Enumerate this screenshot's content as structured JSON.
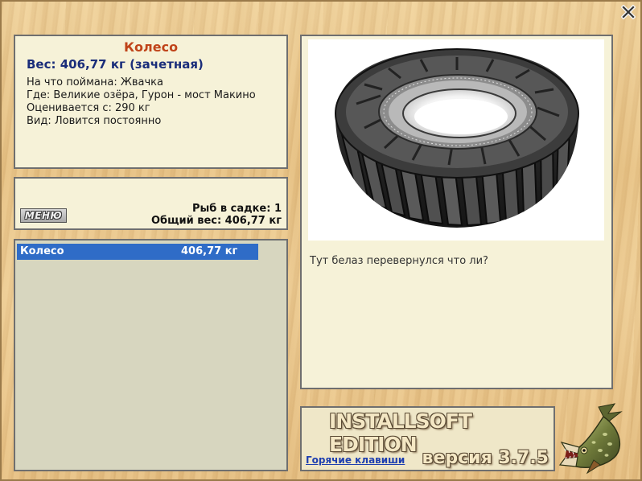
{
  "fish": {
    "name": "Колесо",
    "weight_line": "Вес: 406,77 кг (зачетная)",
    "caught_on": "На что поймана: Жвачка",
    "location": "Где: Великие озёра, Гурон - мост Макино",
    "value": "Оценивается с: 290 кг",
    "type": "Вид: Ловится постоянно",
    "caption": "Тут белаз перевернулся что ли?"
  },
  "summary": {
    "menu_label": "МЕНЮ",
    "fish_count": "Рыб в садке: 1",
    "total_weight": "Общий вес: 406,77 кг"
  },
  "catch_list": [
    {
      "name": "Колесо",
      "weight": "406,77 кг"
    }
  ],
  "footer": {
    "edition": "INSTALLSOFT EDITION",
    "version": "версия 3.7.5",
    "hotkeys": "Горячие клавиши"
  },
  "icons": {
    "close": "close-icon",
    "tire": "tire-image",
    "pike": "pike-fish-icon"
  },
  "colors": {
    "title": "#c0441a",
    "weight": "#1a2d7a",
    "selection": "#2f6cc7",
    "link": "#1e3fb0"
  }
}
